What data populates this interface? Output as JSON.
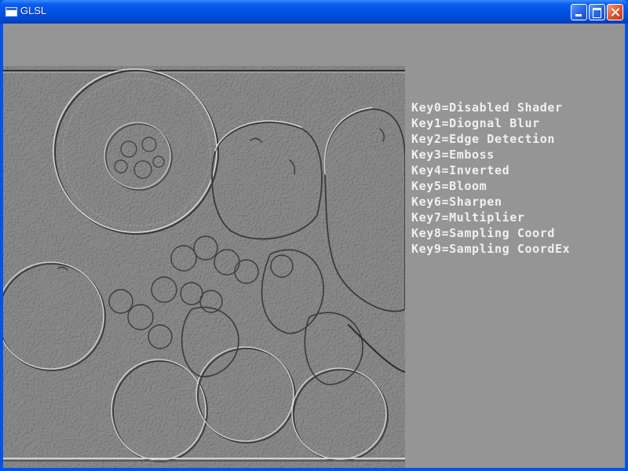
{
  "window": {
    "title": "GLSL"
  },
  "titlebar_buttons": {
    "minimize_icon": "minimize-icon",
    "maximize_icon": "maximize-icon",
    "close_icon": "close-icon"
  },
  "viewport": {
    "image": "emboss-filtered fruit still life (grapefruit, oranges, strawberries, grapes)"
  },
  "key_help": [
    "Key0=Disabled Shader",
    "Key1=Diognal Blur",
    "Key2=Edge Detection",
    "Key3=Emboss",
    "Key4=Inverted",
    "Key5=Bloom",
    "Key6=Sharpen",
    "Key7=Multiplier",
    "Key8=Sampling Coord",
    "Key9=Sampling CoordEx"
  ],
  "colors": {
    "titlebar": "#0054e3",
    "client_background": "#959595",
    "text": "#f0f0f0",
    "close_button": "#e0522a"
  }
}
